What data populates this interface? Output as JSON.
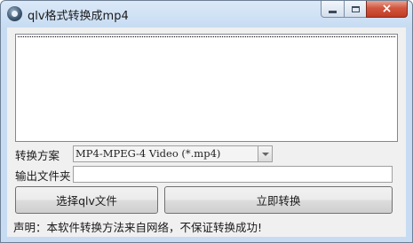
{
  "window": {
    "title": "qlv格式转换成mp4",
    "close_glyph": "×"
  },
  "form": {
    "scheme_label": "转换方案",
    "scheme_selected": "MP4-MPEG-4 Video (*.mp4)",
    "folder_label": "输出文件夹",
    "folder_value": ""
  },
  "buttons": {
    "select_label": "选择qlv文件",
    "convert_label": "立即转换"
  },
  "footer": {
    "disclaimer": "声明：本软件转换方法来自网络，不保证转换成功!"
  },
  "colors": {
    "close_button": "#c13b24",
    "client_bg": "#f0f0f0",
    "titlebar": "#c7dcf2"
  }
}
